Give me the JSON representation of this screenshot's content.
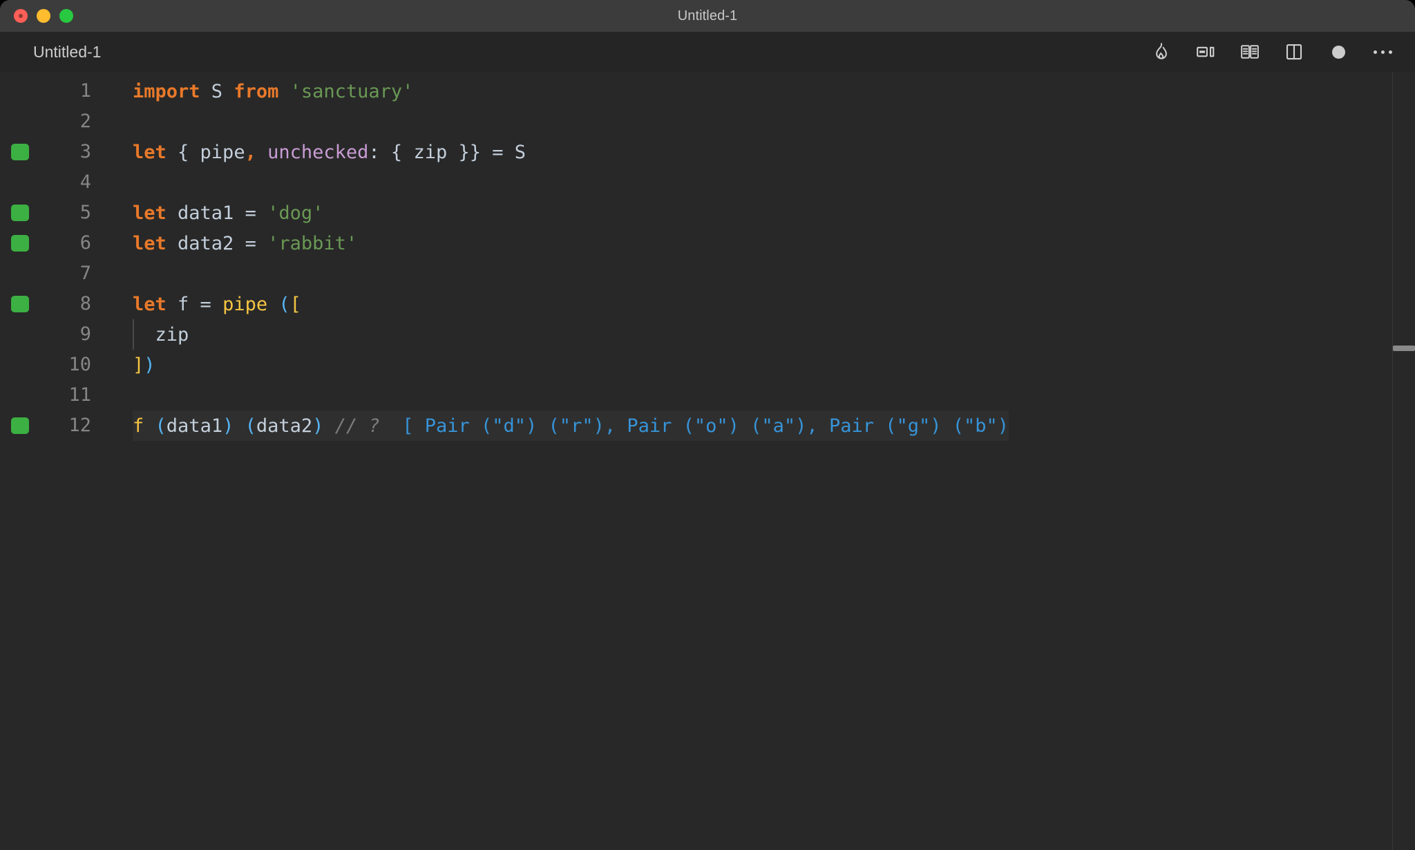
{
  "window": {
    "title": "Untitled-1",
    "traffic_lights": [
      "close",
      "minimize",
      "maximize"
    ]
  },
  "tabbar": {
    "tab_label": "Untitled-1",
    "actions": [
      {
        "name": "flame-icon",
        "label": "Run / Quokka"
      },
      {
        "name": "split-editor-right-icon",
        "label": "Split Editor Right"
      },
      {
        "name": "open-changes-icon",
        "label": "Open Changes"
      },
      {
        "name": "split-panel-icon",
        "label": "Toggle Panel"
      },
      {
        "name": "circle-dot-icon",
        "label": "Record"
      },
      {
        "name": "more-actions-icon",
        "label": "More Actions..."
      }
    ]
  },
  "editor": {
    "language": "javascript",
    "breakpoint_lines": [
      3,
      5,
      6,
      8,
      12
    ],
    "current_line": 12,
    "lines": [
      {
        "number": "1",
        "tokens": [
          {
            "text": "import",
            "kind": "keyword"
          },
          {
            "text": " S ",
            "kind": "plain"
          },
          {
            "text": "from",
            "kind": "keyword"
          },
          {
            "text": " ",
            "kind": "plain"
          },
          {
            "text": "'sanctuary'",
            "kind": "string"
          }
        ]
      },
      {
        "number": "2",
        "tokens": []
      },
      {
        "number": "3",
        "tokens": [
          {
            "text": "let",
            "kind": "keyword"
          },
          {
            "text": " { pipe",
            "kind": "plain"
          },
          {
            "text": ",",
            "kind": "keyword"
          },
          {
            "text": " ",
            "kind": "plain"
          },
          {
            "text": "unchecked",
            "kind": "property"
          },
          {
            "text": ": { zip }} = S",
            "kind": "plain"
          }
        ]
      },
      {
        "number": "4",
        "tokens": []
      },
      {
        "number": "5",
        "tokens": [
          {
            "text": "let",
            "kind": "keyword"
          },
          {
            "text": " data1 = ",
            "kind": "plain"
          },
          {
            "text": "'dog'",
            "kind": "string"
          }
        ]
      },
      {
        "number": "6",
        "tokens": [
          {
            "text": "let",
            "kind": "keyword"
          },
          {
            "text": " data2 = ",
            "kind": "plain"
          },
          {
            "text": "'rabbit'",
            "kind": "string"
          }
        ]
      },
      {
        "number": "7",
        "tokens": []
      },
      {
        "number": "8",
        "tokens": [
          {
            "text": "let",
            "kind": "keyword"
          },
          {
            "text": " f = ",
            "kind": "plain"
          },
          {
            "text": "pipe",
            "kind": "function"
          },
          {
            "text": " ",
            "kind": "plain"
          },
          {
            "text": "(",
            "kind": "paren-blue"
          },
          {
            "text": "[",
            "kind": "paren-yellow"
          }
        ]
      },
      {
        "number": "9",
        "indent_guide": true,
        "tokens": [
          {
            "text": "  zip",
            "kind": "plain"
          }
        ]
      },
      {
        "number": "10",
        "tokens": [
          {
            "text": "]",
            "kind": "paren-yellow"
          },
          {
            "text": ")",
            "kind": "paren-blue"
          }
        ]
      },
      {
        "number": "11",
        "tokens": []
      },
      {
        "number": "12",
        "current": true,
        "tokens": [
          {
            "text": "f",
            "kind": "function"
          },
          {
            "text": " ",
            "kind": "plain"
          },
          {
            "text": "(",
            "kind": "paren-blue"
          },
          {
            "text": "data1",
            "kind": "plain"
          },
          {
            "text": ")",
            "kind": "paren-blue"
          },
          {
            "text": " ",
            "kind": "plain"
          },
          {
            "text": "(",
            "kind": "paren-blue"
          },
          {
            "text": "data2",
            "kind": "plain"
          },
          {
            "text": ")",
            "kind": "paren-blue"
          },
          {
            "text": " ",
            "kind": "plain"
          },
          {
            "text": "// ?",
            "kind": "comment"
          },
          {
            "text": "  ",
            "kind": "plain"
          },
          {
            "text": "[ Pair (\"d\") (\"r\"), Pair (\"o\") (\"a\"), Pair (\"g\") (\"b\")",
            "kind": "hint"
          }
        ]
      }
    ]
  },
  "colors": {
    "window_chrome": "#3c3c3c",
    "tabbar_bg": "#252526",
    "editor_bg": "#282828",
    "current_line_bg": "#2f2f2f",
    "keyword": "#e8792a",
    "plain": "#c3cfdb",
    "string": "#6a9955",
    "property": "#c89cd4",
    "function": "#f5c542",
    "paren_blue": "#57b6f5",
    "comment": "#7d7d7d",
    "inline_hint": "#3794d8",
    "breakpoint_green": "#3cb043",
    "linenumber": "#868686"
  }
}
